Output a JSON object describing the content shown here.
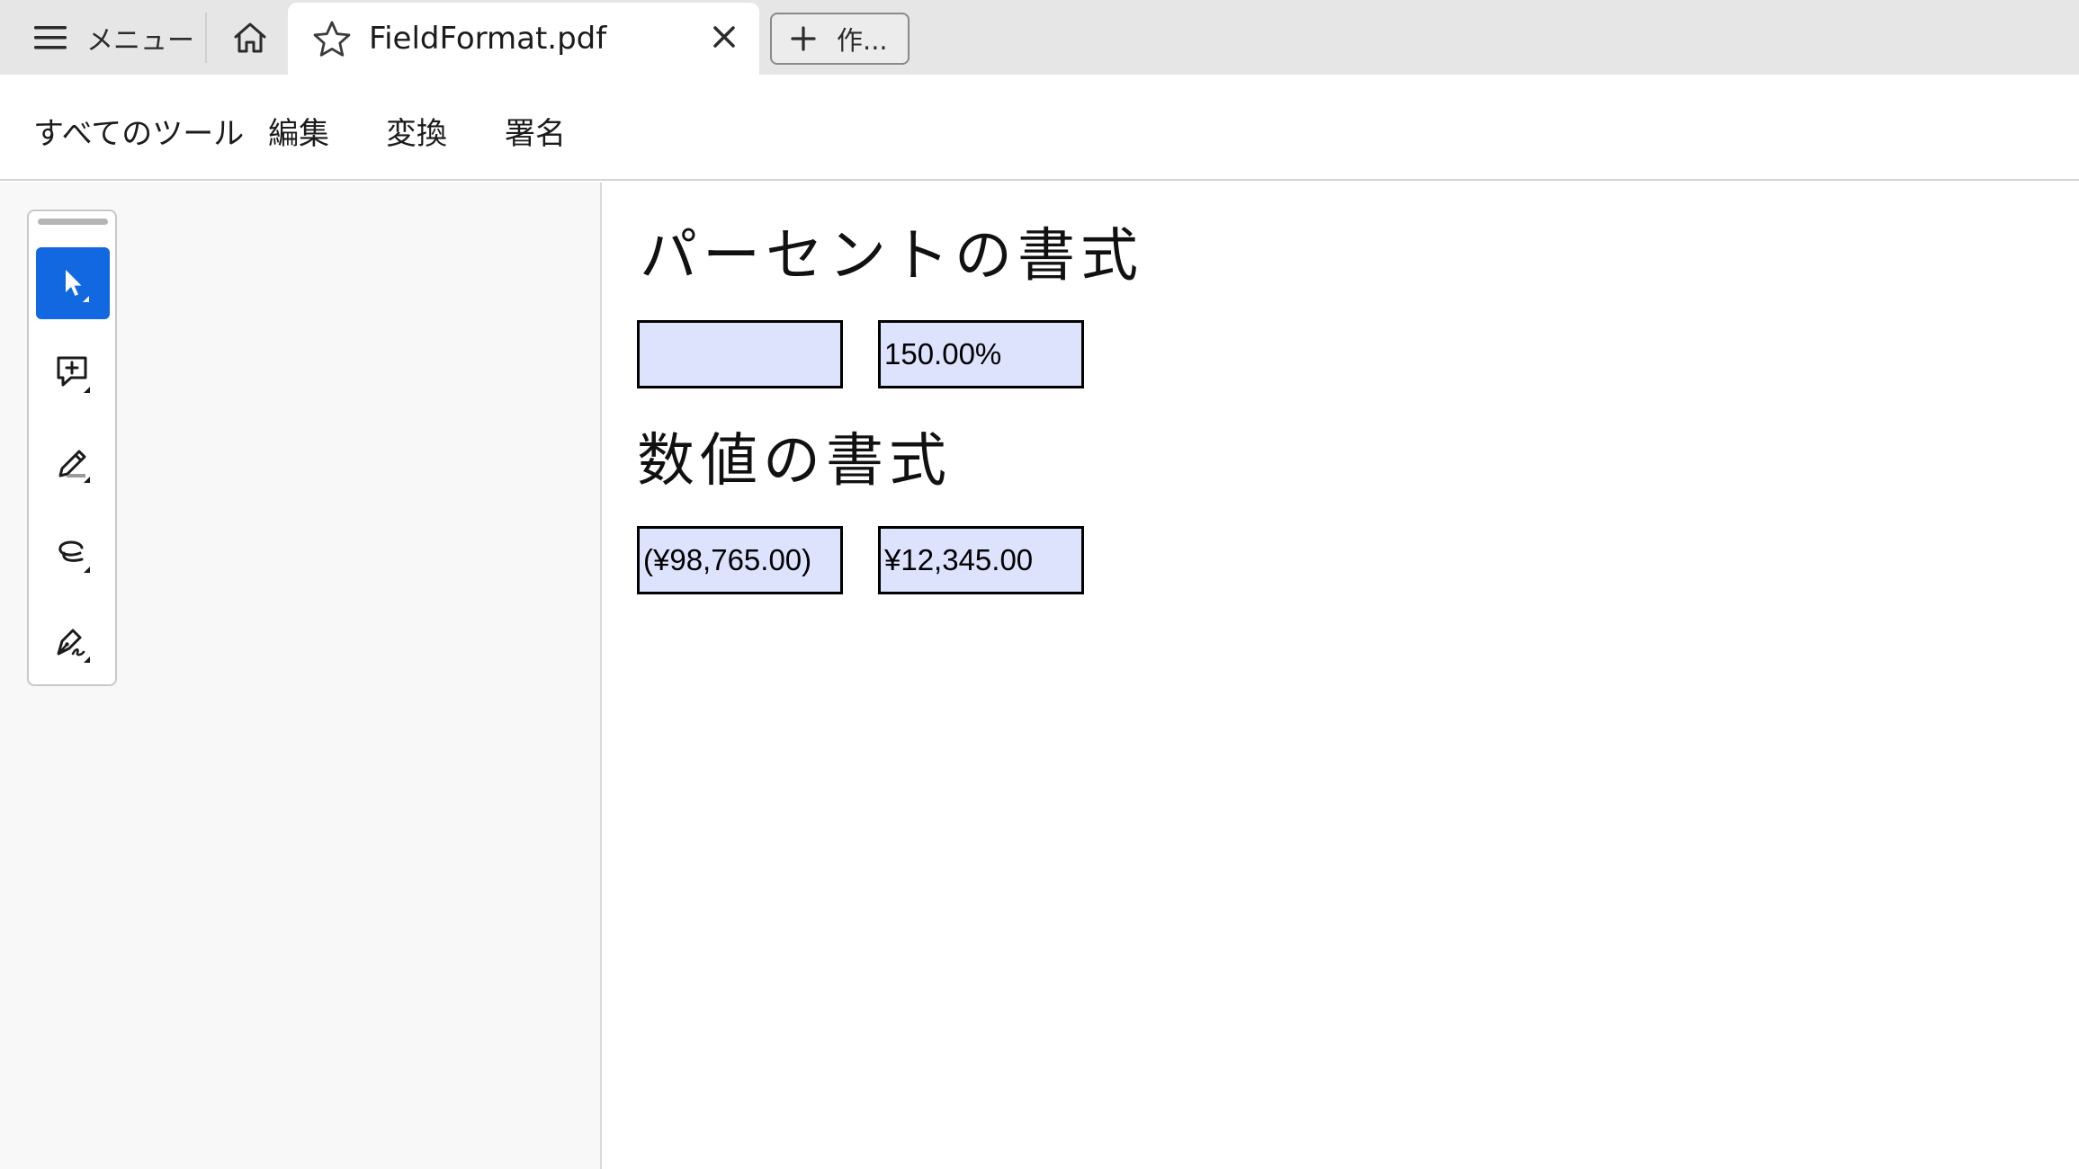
{
  "tabbar": {
    "menu_label": "メニュー",
    "home_icon": "home-icon",
    "document_tab": {
      "title": "FieldFormat.pdf",
      "star_icon": "star-icon",
      "close_icon": "close-icon"
    },
    "new_tab_label": "作..."
  },
  "toolbar": {
    "items": [
      "すべてのツール",
      "編集",
      "変換",
      "署名"
    ]
  },
  "tools": [
    {
      "name": "select-tool",
      "icon": "cursor-arrow-icon",
      "active": true
    },
    {
      "name": "comment-tool",
      "icon": "add-comment-icon",
      "active": false
    },
    {
      "name": "highlight-tool",
      "icon": "highlighter-pen-icon",
      "active": false
    },
    {
      "name": "draw-tool",
      "icon": "freehand-lasso-icon",
      "active": false
    },
    {
      "name": "sign-tool",
      "icon": "fountain-pen-sign-icon",
      "active": false
    }
  ],
  "document": {
    "percent_section": {
      "heading": "パーセントの書式",
      "fields": [
        "",
        "150.00%"
      ]
    },
    "number_section": {
      "heading": "数値の書式",
      "fields": [
        "(¥98,765.00)",
        "¥12,345.00"
      ]
    }
  },
  "colors": {
    "accent": "#1168e0",
    "field_fill": "#dde3fd",
    "tabbar_bg": "#e6e6e6"
  }
}
